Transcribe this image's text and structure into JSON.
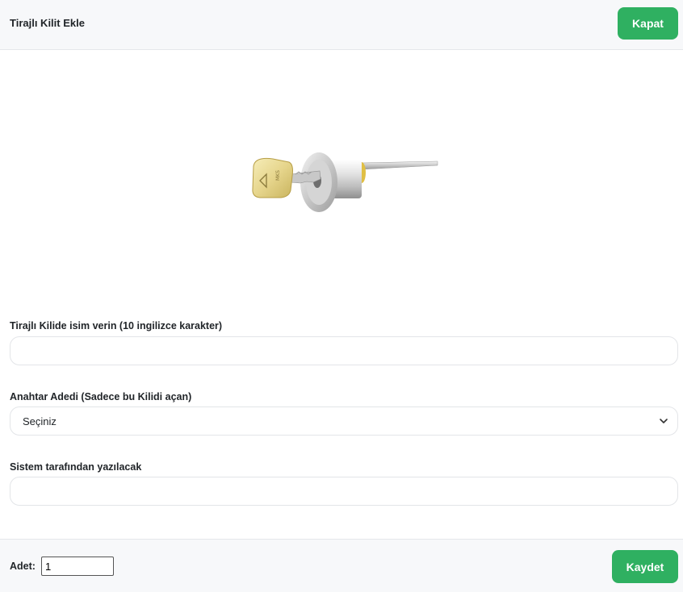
{
  "header": {
    "title": "Tirajlı Kilit Ekle",
    "close_label": "Kapat"
  },
  "product": {
    "image": "lock-cylinder-with-key",
    "key_brand_text": "MKS"
  },
  "form": {
    "name_label": "Tirajlı Kilide isim verin (10 ingilizce karakter)",
    "name_value": "",
    "key_count_label": "Anahtar Adedi (Sadece bu Kilidi açan)",
    "key_count_selected": "Seçiniz",
    "system_label": "Sistem tarafından yazılacak",
    "system_value": ""
  },
  "footer": {
    "qty_label": "Adet:",
    "qty_value": "1",
    "save_label": "Kaydet"
  },
  "colors": {
    "accent": "#2fb061",
    "header_bg": "#f7f8fa",
    "border": "#e3e5e8"
  }
}
